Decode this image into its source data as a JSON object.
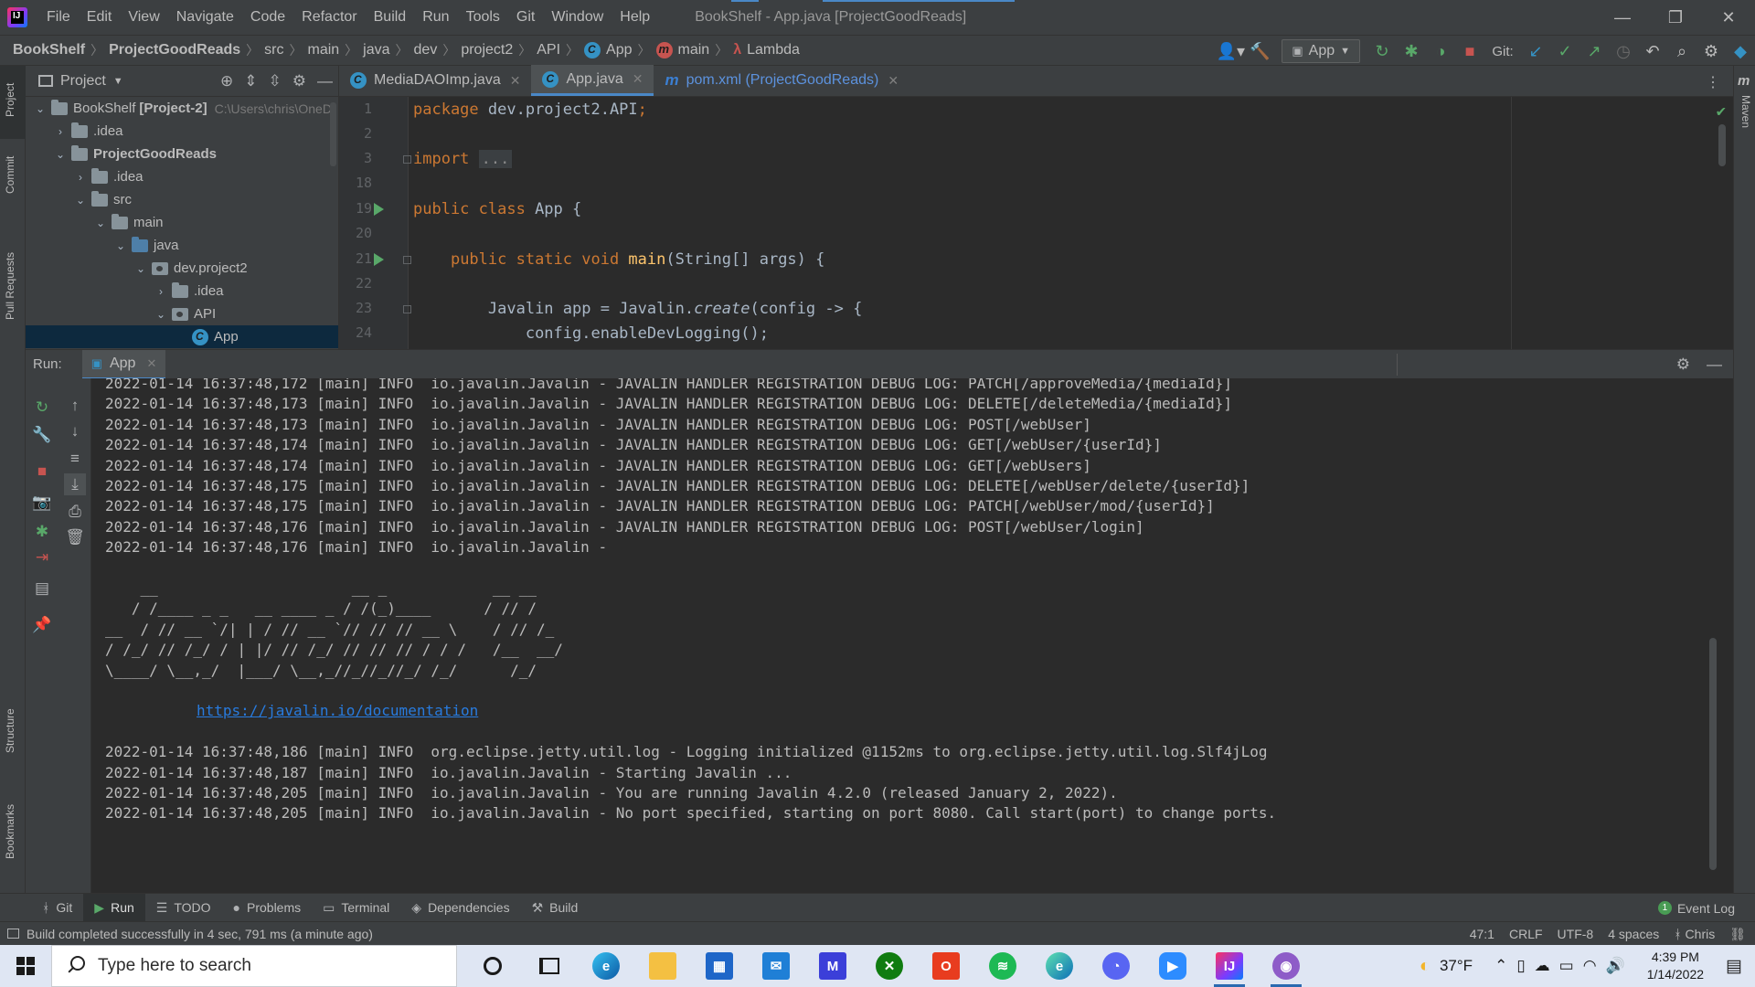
{
  "titlebar": {
    "menu": [
      "File",
      "Edit",
      "View",
      "Navigate",
      "Code",
      "Refactor",
      "Build",
      "Run",
      "Tools",
      "Git",
      "Window",
      "Help"
    ],
    "window_title": "BookShelf - App.java [ProjectGoodReads]",
    "controls": [
      "—",
      "❐",
      "✕"
    ]
  },
  "navbar": {
    "breadcrumbs": [
      "BookShelf",
      "ProjectGoodReads",
      "src",
      "main",
      "java",
      "dev",
      "project2",
      "API",
      "App",
      "main",
      "Lambda"
    ],
    "run_config": "App",
    "git_label": "Git:"
  },
  "stripes": {
    "left": [
      "Project",
      "Commit",
      "Pull Requests",
      "Structure",
      "Bookmarks"
    ],
    "right": [
      "Maven"
    ]
  },
  "project_panel": {
    "title": "Project",
    "tree": [
      {
        "label": "BookShelf",
        "bold_suffix": "[Project-2]",
        "path": "C:\\Users\\chris\\OneD",
        "depth": 0,
        "arrow": "⌄",
        "type": "folder"
      },
      {
        "label": ".idea",
        "depth": 1,
        "arrow": "›",
        "type": "folder"
      },
      {
        "label": "ProjectGoodReads",
        "depth": 1,
        "arrow": "⌄",
        "type": "folder",
        "bold": true
      },
      {
        "label": ".idea",
        "depth": 2,
        "arrow": "›",
        "type": "folder"
      },
      {
        "label": "src",
        "depth": 2,
        "arrow": "⌄",
        "type": "folder"
      },
      {
        "label": "main",
        "depth": 3,
        "arrow": "⌄",
        "type": "folder"
      },
      {
        "label": "java",
        "depth": 4,
        "arrow": "⌄",
        "type": "folder-blue"
      },
      {
        "label": "dev.project2",
        "depth": 5,
        "arrow": "⌄",
        "type": "package"
      },
      {
        "label": ".idea",
        "depth": 6,
        "arrow": "›",
        "type": "folder"
      },
      {
        "label": "API",
        "depth": 6,
        "arrow": "⌄",
        "type": "package"
      },
      {
        "label": "App",
        "depth": 7,
        "arrow": "",
        "type": "class",
        "selected": true
      }
    ]
  },
  "editor": {
    "tabs": [
      {
        "label": "MediaDAOImp.java",
        "icon": "class-icon",
        "active": false
      },
      {
        "label": "App.java",
        "icon": "class-icon",
        "active": true
      },
      {
        "label": "pom.xml (ProjectGoodReads)",
        "icon": "maven-icon",
        "active": false
      }
    ],
    "line_numbers": [
      "1",
      "2",
      "3",
      "18",
      "19",
      "20",
      "21",
      "22",
      "23",
      "24"
    ],
    "code": {
      "l1_kw": "package ",
      "l1_rest": "dev.project2.API",
      "l1_semi": ";",
      "l3_kw": "import ",
      "l3_fold": "...",
      "l19_kw": "public class ",
      "l19_rest": "App {",
      "l21_kw": "public static void ",
      "l21_fn": "main",
      "l21_rest": "(String[] args) {",
      "l23_a": "Javalin app = Javalin.",
      "l23_it": "create",
      "l23_b": "(config -> {",
      "l24": "config.enableDevLogging();"
    }
  },
  "run_panel": {
    "label": "Run:",
    "tab": "App"
  },
  "console": {
    "lines": [
      "2022-01-14 16:37:48,172 [main] INFO  io.javalin.Javalin - JAVALIN HANDLER REGISTRATION DEBUG LOG: PATCH[/approveMedia/{mediaId}]",
      "2022-01-14 16:37:48,173 [main] INFO  io.javalin.Javalin - JAVALIN HANDLER REGISTRATION DEBUG LOG: DELETE[/deleteMedia/{mediaId}]",
      "2022-01-14 16:37:48,173 [main] INFO  io.javalin.Javalin - JAVALIN HANDLER REGISTRATION DEBUG LOG: POST[/webUser]",
      "2022-01-14 16:37:48,174 [main] INFO  io.javalin.Javalin - JAVALIN HANDLER REGISTRATION DEBUG LOG: GET[/webUser/{userId}]",
      "2022-01-14 16:37:48,174 [main] INFO  io.javalin.Javalin - JAVALIN HANDLER REGISTRATION DEBUG LOG: GET[/webUsers]",
      "2022-01-14 16:37:48,175 [main] INFO  io.javalin.Javalin - JAVALIN HANDLER REGISTRATION DEBUG LOG: DELETE[/webUser/delete/{userId}]",
      "2022-01-14 16:37:48,175 [main] INFO  io.javalin.Javalin - JAVALIN HANDLER REGISTRATION DEBUG LOG: PATCH[/webUser/mod/{userId}]",
      "2022-01-14 16:37:48,176 [main] INFO  io.javalin.Javalin - JAVALIN HANDLER REGISTRATION DEBUG LOG: POST[/webUser/login]",
      "2022-01-14 16:37:48,176 [main] INFO  io.javalin.Javalin - "
    ],
    "ascii_art": [
      "    __                      __ _            __ __",
      "   / /____ _ _   __ ____ _ / /(_)____      / // /",
      "__  / // __ `/| | / // __ `// // // __ \\    / // /_",
      "/ /_/ // /_/ / | |/ // /_/ // // // / / /   /__  __/",
      "\\____/ \\__,_/  |___/ \\__,_//_//_//_/ /_/      /_/"
    ],
    "link": "https://javalin.io/documentation",
    "lines_after": [
      "2022-01-14 16:37:48,186 [main] INFO  org.eclipse.jetty.util.log - Logging initialized @1152ms to org.eclipse.jetty.util.log.Slf4jLog",
      "2022-01-14 16:37:48,187 [main] INFO  io.javalin.Javalin - Starting Javalin ...",
      "2022-01-14 16:37:48,205 [main] INFO  io.javalin.Javalin - You are running Javalin 4.2.0 (released January 2, 2022).",
      "2022-01-14 16:37:48,205 [main] INFO  io.javalin.Javalin - No port specified, starting on port 8080. Call start(port) to change ports."
    ]
  },
  "tool_tabs": {
    "items": [
      {
        "label": "Git",
        "icon": "git-icon"
      },
      {
        "label": "Run",
        "icon": "run-icon",
        "active": true
      },
      {
        "label": "TODO",
        "icon": "todo-icon"
      },
      {
        "label": "Problems",
        "icon": "problems-icon"
      },
      {
        "label": "Terminal",
        "icon": "terminal-icon"
      },
      {
        "label": "Dependencies",
        "icon": "dependencies-icon"
      },
      {
        "label": "Build",
        "icon": "build-icon"
      }
    ],
    "event_log": "Event Log",
    "event_count": "1"
  },
  "statusbar": {
    "message": "Build completed successfully in 4 sec, 791 ms (a minute ago)",
    "position": "47:1",
    "line_sep": "CRLF",
    "encoding": "UTF-8",
    "indent": "4 spaces",
    "branch": "Chris"
  },
  "taskbar": {
    "search_placeholder": "Type here to search",
    "weather": "37°F",
    "time": "4:39 PM",
    "date": "1/14/2022"
  },
  "colors": {
    "accent": "#4a88c7",
    "keyword": "#cc7832",
    "function": "#ffc66d",
    "run_green": "#59a869",
    "link": "#287bde"
  }
}
